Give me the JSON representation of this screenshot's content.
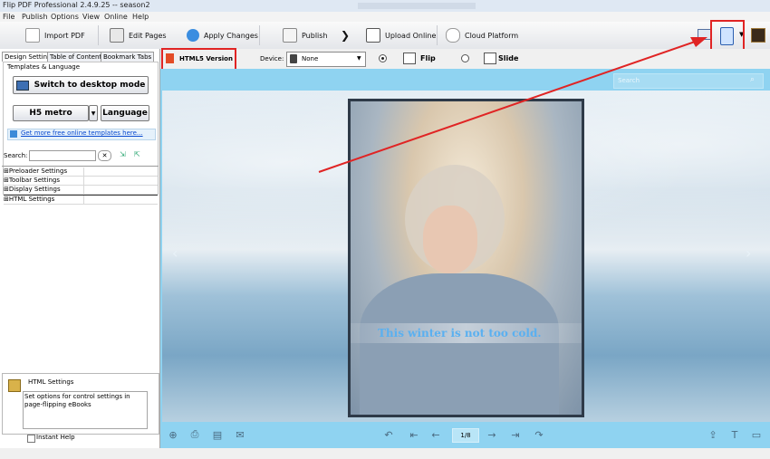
{
  "window": {
    "title": "Flip PDF Professional 2.4.9.25 -- season2"
  },
  "menu": {
    "items": [
      "File",
      "Publish",
      "Options",
      "View",
      "Online",
      "Help"
    ]
  },
  "toolbar": {
    "import_pdf": "Import PDF",
    "edit_pages": "Edit Pages",
    "apply_changes": "Apply Changes",
    "publish": "Publish",
    "upload_online": "Upload Online",
    "cloud_platform": "Cloud Platform"
  },
  "left_panel": {
    "tabs": [
      "Design Settings",
      "Table of Contents",
      "Bookmark Tabs"
    ],
    "templates_label": "Templates & Language",
    "switch_desktop": "Switch to desktop mode",
    "template_name": "H5 metro",
    "language": "Language",
    "more_templates": "Get more free online templates here...",
    "search_label": "Search:",
    "search_value": "",
    "settings_tree": [
      "Preloader Settings",
      "Toolbar Settings",
      "Display Settings",
      "HTML Settings"
    ],
    "help_title": "HTML Settings",
    "help_text": "Set options for control settings in page-flipping eBooks",
    "instant_help": "Instant Help"
  },
  "preview_bar": {
    "html5_version": "HTML5 Version",
    "device_label": "Device:",
    "device_value": "None",
    "flip_label": "Flip",
    "slide_label": "Slide"
  },
  "viewer": {
    "search_placeholder": "Search",
    "page_caption": "This winter is not too cold.",
    "page_indicator": "1/8"
  },
  "colors": {
    "viewer_bg": "#8fd3f1",
    "highlight": "#e02424",
    "caption": "#5ab0f0"
  }
}
